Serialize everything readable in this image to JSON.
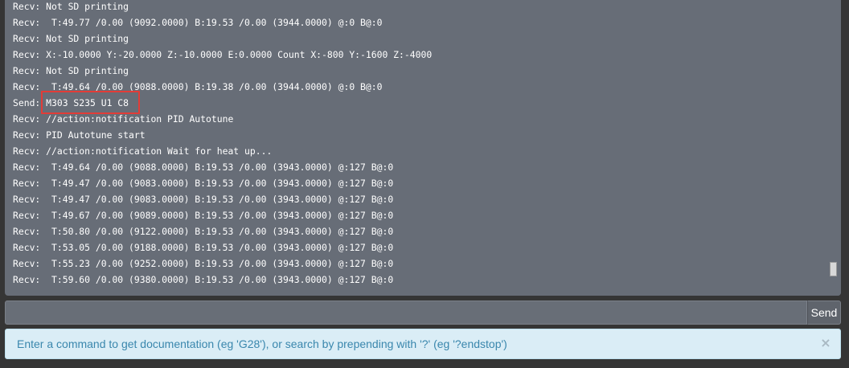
{
  "terminal": {
    "lines": [
      "Recv: Not SD printing",
      "Recv:  T:49.77 /0.00 (9092.0000) B:19.53 /0.00 (3944.0000) @:0 B@:0",
      "Recv: Not SD printing",
      "Recv: X:-10.0000 Y:-20.0000 Z:-10.0000 E:0.0000 Count X:-800 Y:-1600 Z:-4000",
      "Recv: Not SD printing",
      "Recv:  T:49.64 /0.00 (9088.0000) B:19.38 /0.00 (3944.0000) @:0 B@:0",
      "Send: M303 S235 U1 C8",
      "Recv: //action:notification PID Autotune",
      "Recv: PID Autotune start",
      "Recv: //action:notification Wait for heat up...",
      "Recv:  T:49.64 /0.00 (9088.0000) B:19.53 /0.00 (3943.0000) @:127 B@:0",
      "Recv:  T:49.47 /0.00 (9083.0000) B:19.53 /0.00 (3943.0000) @:127 B@:0",
      "Recv:  T:49.47 /0.00 (9083.0000) B:19.53 /0.00 (3943.0000) @:127 B@:0",
      "Recv:  T:49.67 /0.00 (9089.0000) B:19.53 /0.00 (3943.0000) @:127 B@:0",
      "Recv:  T:50.80 /0.00 (9122.0000) B:19.53 /0.00 (3943.0000) @:127 B@:0",
      "Recv:  T:53.05 /0.00 (9188.0000) B:19.53 /0.00 (3943.0000) @:127 B@:0",
      "Recv:  T:55.23 /0.00 (9252.0000) B:19.53 /0.00 (3943.0000) @:127 B@:0",
      "Recv:  T:59.60 /0.00 (9380.0000) B:19.53 /0.00 (3943.0000) @:127 B@:0"
    ],
    "highlight_color": "#e23c37"
  },
  "command": {
    "value": "",
    "send_label": "Send"
  },
  "info": {
    "text": "Enter a command to get documentation (eg 'G28'), or search by prepending with '?' (eg '?endstop')",
    "close_symbol": "×",
    "color": "#3a87ad"
  }
}
